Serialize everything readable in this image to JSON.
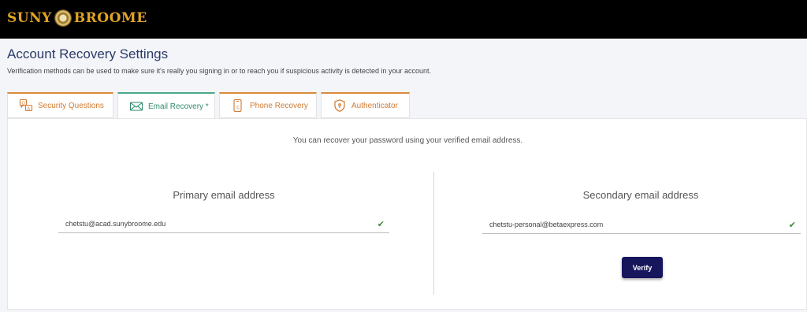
{
  "header": {
    "logo_left": "SUNY",
    "logo_right": "BROOME",
    "brand_color": "#e0a426"
  },
  "page": {
    "title": "Account Recovery Settings",
    "description": "Verification methods can be used to make sure it's really you signing in or to reach you if suspicious activity is detected in your account."
  },
  "tabs": [
    {
      "label": "Security Questions",
      "icon": "security-questions-icon"
    },
    {
      "label": "Email Recovery *",
      "icon": "email-recovery-icon",
      "active": true
    },
    {
      "label": "Phone Recovery",
      "icon": "phone-recovery-icon"
    },
    {
      "label": "Authenticator",
      "icon": "shield-icon"
    }
  ],
  "email_recovery": {
    "intro": "You can recover your password using your verified email address.",
    "primary": {
      "heading": "Primary email address",
      "value": "chetstu@acad.sunybroome.edu",
      "verified": true
    },
    "secondary": {
      "heading": "Secondary email address",
      "value": "chetstu-personal@betaexpress.com",
      "verified": true
    },
    "verify_label": "Verify"
  },
  "colors": {
    "tab_accent": "#d98a3d",
    "active_tab_accent": "#4aa88a",
    "verify_button": "#17165d",
    "title": "#2b3a67"
  }
}
